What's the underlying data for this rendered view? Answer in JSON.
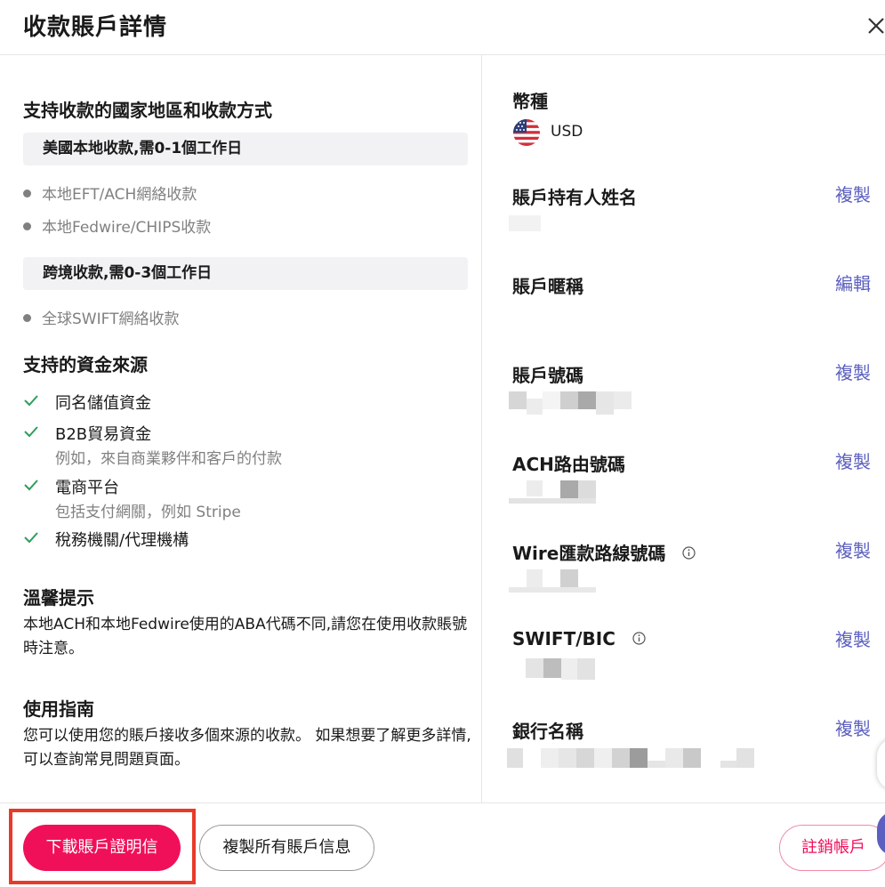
{
  "header": {
    "title": "收款賬戶詳情"
  },
  "left": {
    "supported_title": "支持收款的國家地區和收款方式",
    "methods": [
      {
        "heading": "美國本地收款,需0-1個工作日",
        "items": [
          "本地EFT/ACH網絡收款",
          "本地Fedwire/CHIPS收款"
        ]
      },
      {
        "heading": "跨境收款,需0-3個工作日",
        "items": [
          "全球SWIFT網絡收款"
        ]
      }
    ],
    "sources_title": "支持的資金來源",
    "sources": [
      {
        "label": "同名儲值資金",
        "sub": ""
      },
      {
        "label": "B2B貿易資金",
        "sub": "例如，來自商業夥伴和客戶的付款"
      },
      {
        "label": "電商平台",
        "sub": "包括支付網關，例如 Stripe"
      },
      {
        "label": "稅務機關/代理機構",
        "sub": ""
      }
    ],
    "tip_title": "溫馨提示",
    "tip_text": "本地ACH和本地Fedwire使用的ABA代碼不同,請您在使用收款賬號時注意。",
    "guide_title": "使用指南",
    "guide_text": "您可以使用您的賬戶接收多個來源的收款。 如果想要了解更多詳情,可以查詢常見問題頁面。"
  },
  "right": {
    "currency_label": "幣種",
    "currency_value": "USD",
    "fields": [
      {
        "label": "賬戶持有人姓名",
        "action": "複製"
      },
      {
        "label": "賬戶暱稱",
        "action": "編輯"
      },
      {
        "label": "賬戶號碼",
        "action": "複製"
      },
      {
        "label": "ACH路由號碼",
        "action": "複製"
      },
      {
        "label": "Wire匯款路線號碼",
        "action": "複製"
      },
      {
        "label": "SWIFT/BIC",
        "action": "複製"
      },
      {
        "label": "銀行名稱",
        "action": "複製"
      }
    ]
  },
  "footer": {
    "download_label": "下載賬戶證明信",
    "copy_all_label": "複製所有賬戶信息",
    "cancel_label": "註銷帳戶"
  },
  "colors": {
    "primary": "#f0105a",
    "link": "#5b5fbf",
    "check": "#2e9e5b",
    "highlight": "#e83a2a"
  }
}
